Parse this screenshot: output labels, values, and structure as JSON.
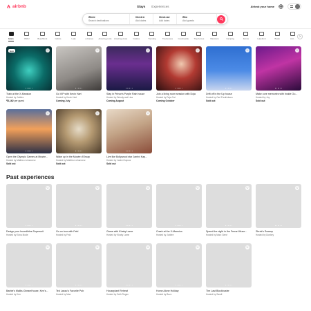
{
  "header": {
    "logo_text": "airbnb",
    "nav": [
      "Stays",
      "Experiences"
    ],
    "host_link": "Airbnb your home"
  },
  "search": {
    "where_label": "Where",
    "where_placeholder": "Search destinations",
    "checkin_label": "Check in",
    "checkin_placeholder": "Add dates",
    "checkout_label": "Check out",
    "checkout_placeholder": "Add dates",
    "who_label": "Who",
    "who_placeholder": "Add guests"
  },
  "categories": [
    "Icons",
    "OMG!",
    "Beachfront",
    "Cabins",
    "Lake",
    "A-frames",
    "Amazing pools",
    "Amazing views",
    "Castles",
    "Trending",
    "Treehouses",
    "Countryside",
    "Tiny homes",
    "Mansions",
    "Camping",
    "Farms",
    "Lakefront",
    "Boats",
    "Arct..."
  ],
  "icons": [
    {
      "title": "Train at the X-Mansion",
      "host": "Hosted by Jubilee",
      "price": "₹3,162",
      "price_suffix": " per guest",
      "badge": "Icon",
      "art": "img1"
    },
    {
      "title": "Go VIP with Kevin Hart",
      "host": "Hosted by Kevin Hart",
      "status": "Coming July",
      "art": "img2"
    },
    {
      "title": "Stay in Prince's Purple Rain house",
      "host": "Hosted by Wendy and Lisa",
      "status": "Coming August",
      "art": "img3"
    },
    {
      "title": "Join a living room session with Doja",
      "host": "Hosted by Doja Cat",
      "status": "Coming October",
      "art": "img4"
    },
    {
      "title": "Drift off in the Up house",
      "host": "Hosted by Carl Fredricksen",
      "status": "Sold out",
      "art": "img5"
    },
    {
      "title": "Make core memories with Inside Ou...",
      "host": "Hosted by Joy",
      "status": "Sold out",
      "art": "img6"
    },
    {
      "title": "Open the Olympic Games at Musée...",
      "host": "Hosted by Mathieu Lehanneur",
      "status": "Sold out",
      "art": "img7"
    },
    {
      "title": "Wake up in the Musée d'Orsay",
      "host": "Hosted by Mathieu Lehanneur",
      "status": "Sold out",
      "art": "img8"
    },
    {
      "title": "Live like Bollywood star Janhvi Kap...",
      "host": "Hosted by Janhvi Kapoor",
      "status": "Sold out",
      "art": "img9"
    }
  ],
  "past_title": "Past experiences",
  "past": [
    {
      "title": "Design your Incredibles Supersuit",
      "host": "Hosted by Edna Mode"
    },
    {
      "title": "Go on tour with Feid",
      "host": "Hosted by Feid"
    },
    {
      "title": "Game with Khaby Lame",
      "host": "Hosted by Khaby Lame"
    },
    {
      "title": "Crash at the X-Mansion",
      "host": "Hosted by Jubilee"
    },
    {
      "title": "Spend the night in the Ferrari Muse...",
      "host": "Hosted by Marc Gené"
    },
    {
      "title": "Shrek's Swamp",
      "host": "Hosted by Donkey"
    },
    {
      "title": "Barbie's Malibu DreamHouse, Ken's...",
      "host": "Hosted by Ken"
    },
    {
      "title": "Ted Lasso's Favorite Pub",
      "host": "Hosted by Mae"
    },
    {
      "title": "Houseplant Retreat",
      "host": "Hosted by Seth Rogen"
    },
    {
      "title": "Home Alone Holiday",
      "host": "Hosted by Buzz"
    },
    {
      "title": "The Last Blockbuster",
      "host": "Hosted by Sandi"
    }
  ],
  "colors": {
    "brand": "#ff385c",
    "text": "#222222",
    "muted": "#717171",
    "placeholder": "#dddddd"
  }
}
